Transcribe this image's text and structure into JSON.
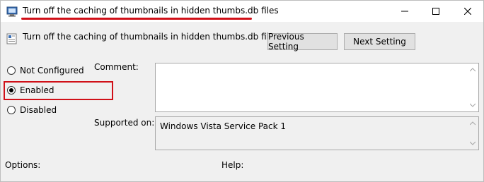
{
  "window": {
    "title": "Turn off the caching of thumbnails in hidden thumbs.db files",
    "controls": {
      "minimize": "minimize-icon",
      "maximize": "maximize-icon",
      "close": "close-icon"
    }
  },
  "policy": {
    "name": "Turn off the caching of thumbnails in hidden thumbs.db files",
    "previous_label": "Previous Setting",
    "next_label": "Next Setting"
  },
  "state": {
    "options": [
      {
        "label": "Not Configured",
        "checked": false
      },
      {
        "label": "Enabled",
        "checked": true
      },
      {
        "label": "Disabled",
        "checked": false
      }
    ]
  },
  "comment": {
    "label": "Comment:",
    "value": ""
  },
  "supported": {
    "label": "Supported on:",
    "value": "Windows Vista Service Pack 1"
  },
  "panes": {
    "options_label": "Options:",
    "help_label": "Help:"
  },
  "colors": {
    "highlight": "#d01018",
    "window_bg": "#f0f0f0",
    "titlebar_bg": "#ffffff"
  }
}
